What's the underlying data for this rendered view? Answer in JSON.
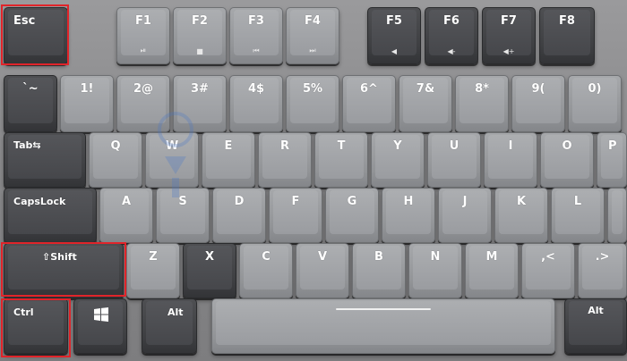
{
  "keyboard": {
    "row_fn": [
      {
        "id": "esc",
        "label": "Esc",
        "sub": ""
      },
      {
        "id": "f1",
        "label": "F1",
        "sub": "⏯"
      },
      {
        "id": "f2",
        "label": "F2",
        "sub": "■"
      },
      {
        "id": "f3",
        "label": "F3",
        "sub": "⏮"
      },
      {
        "id": "f4",
        "label": "F4",
        "sub": "⏭"
      },
      {
        "id": "f5",
        "label": "F5",
        "sub": "◀"
      },
      {
        "id": "f6",
        "label": "F6",
        "sub": "◀-"
      },
      {
        "id": "f7",
        "label": "F7",
        "sub": "◀+"
      },
      {
        "id": "f8",
        "label": "F8",
        "sub": ""
      }
    ],
    "row_num": [
      {
        "id": "backtick",
        "label": "`~"
      },
      {
        "id": "1",
        "label": "1!"
      },
      {
        "id": "2",
        "label": "2@"
      },
      {
        "id": "3",
        "label": "3#"
      },
      {
        "id": "4",
        "label": "4$"
      },
      {
        "id": "5",
        "label": "5%"
      },
      {
        "id": "6",
        "label": "6^"
      },
      {
        "id": "7",
        "label": "7&"
      },
      {
        "id": "8",
        "label": "8*"
      },
      {
        "id": "9",
        "label": "9("
      },
      {
        "id": "0",
        "label": "0)"
      }
    ],
    "row_q": [
      {
        "id": "tab",
        "label": "Tab⇆"
      },
      {
        "id": "q",
        "label": "Q"
      },
      {
        "id": "w",
        "label": "W"
      },
      {
        "id": "e",
        "label": "E"
      },
      {
        "id": "r",
        "label": "R"
      },
      {
        "id": "t",
        "label": "T"
      },
      {
        "id": "y",
        "label": "Y"
      },
      {
        "id": "u",
        "label": "U"
      },
      {
        "id": "i",
        "label": "I"
      },
      {
        "id": "o",
        "label": "O"
      },
      {
        "id": "p",
        "label": "P"
      }
    ],
    "row_a": [
      {
        "id": "capslock",
        "label": "CapsLock"
      },
      {
        "id": "a",
        "label": "A"
      },
      {
        "id": "s",
        "label": "S"
      },
      {
        "id": "d",
        "label": "D"
      },
      {
        "id": "f",
        "label": "F"
      },
      {
        "id": "g",
        "label": "G"
      },
      {
        "id": "h",
        "label": "H"
      },
      {
        "id": "j",
        "label": "J"
      },
      {
        "id": "k",
        "label": "K"
      },
      {
        "id": "l",
        "label": "L"
      }
    ],
    "row_z": [
      {
        "id": "shift",
        "label": "⇧Shift"
      },
      {
        "id": "z",
        "label": "Z"
      },
      {
        "id": "x",
        "label": "X"
      },
      {
        "id": "c",
        "label": "C"
      },
      {
        "id": "v",
        "label": "V"
      },
      {
        "id": "b",
        "label": "B"
      },
      {
        "id": "n",
        "label": "N"
      },
      {
        "id": "m",
        "label": "M"
      },
      {
        "id": "comma",
        "label": ",<"
      },
      {
        "id": "period",
        "label": ".>"
      }
    ],
    "row_bottom": [
      {
        "id": "ctrl",
        "label": "Ctrl"
      },
      {
        "id": "win",
        "label": ""
      },
      {
        "id": "alt-left",
        "label": "Alt"
      },
      {
        "id": "space",
        "label": ""
      },
      {
        "id": "alt-right",
        "label": "Alt"
      }
    ],
    "highlighted_keys": [
      "esc",
      "shift",
      "ctrl"
    ],
    "colors": {
      "highlight": "#e0242a",
      "dark_key": "#45464a",
      "grey_key": "#9a9ca0",
      "legend": "#ffffff"
    }
  }
}
